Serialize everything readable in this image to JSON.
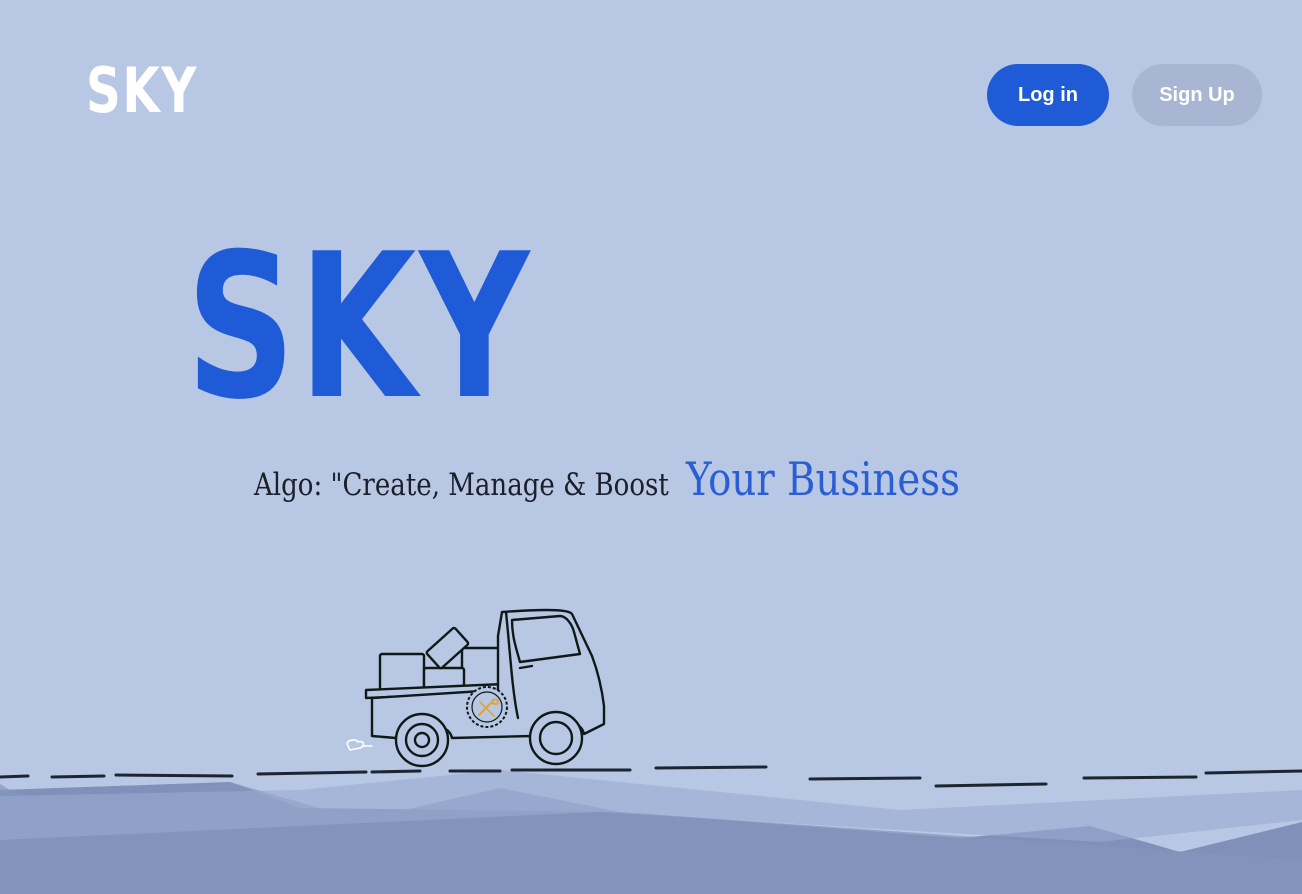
{
  "header": {
    "logo_text": "SKY",
    "login_label": "Log in",
    "signup_label": "Sign Up"
  },
  "hero": {
    "title": "SKY",
    "tagline_prefix": "Algo: \"Create, Manage & Boost",
    "tagline_highlight": "Your Business"
  },
  "colors": {
    "background": "#b8c7e3",
    "accent": "#1f5bd6",
    "signup_bg": "#a8b6d4",
    "hills_dark": "#8190b8",
    "hills_light": "#9aaad0"
  },
  "icons": {
    "truck": "delivery-truck-illustration",
    "badge": "wrench-badge-icon",
    "exhaust": "exhaust-puff-icon"
  }
}
